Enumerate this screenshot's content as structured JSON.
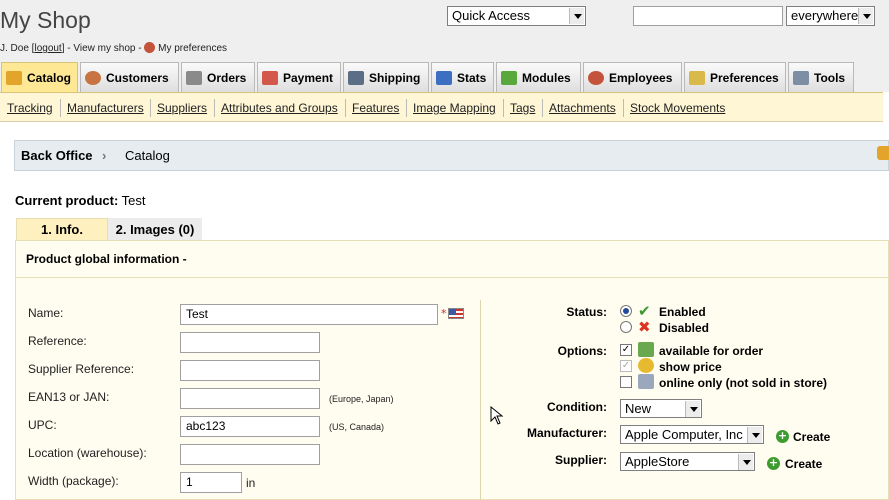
{
  "header": {
    "shop_name": "My Shop",
    "user": "J. Doe [",
    "logout": "logout",
    "user_rest": "] - View my shop -",
    "preferences": "My preferences"
  },
  "quick_access": {
    "value": "Quick Access"
  },
  "search": {
    "value": "",
    "scope": "everywhere"
  },
  "tabs": [
    {
      "label": "Catalog",
      "icon": "catalog-icon",
      "color": "#e2a42b"
    },
    {
      "label": "Customers",
      "icon": "customers-icon",
      "color": "#c87442"
    },
    {
      "label": "Orders",
      "icon": "orders-icon",
      "color": "#8a8a8a"
    },
    {
      "label": "Payment",
      "icon": "payment-icon",
      "color": "#d4584a"
    },
    {
      "label": "Shipping",
      "icon": "shipping-icon",
      "color": "#5a6f86"
    },
    {
      "label": "Stats",
      "icon": "stats-icon",
      "color": "#3c6fc2"
    },
    {
      "label": "Modules",
      "icon": "modules-icon",
      "color": "#58a83c"
    },
    {
      "label": "Employees",
      "icon": "employees-icon",
      "color": "#c4533b"
    },
    {
      "label": "Preferences",
      "icon": "preferences-icon",
      "color": "#d8b94a"
    },
    {
      "label": "Tools",
      "icon": "tools-icon",
      "color": "#7d8ea4"
    }
  ],
  "subnav": [
    "Tracking",
    "Manufacturers",
    "Suppliers",
    "Attributes and Groups",
    "Features",
    "Image Mapping",
    "Tags",
    "Attachments",
    "Stock Movements"
  ],
  "breadcrumb": {
    "root": "Back Office",
    "current": "Catalog"
  },
  "product": {
    "current_label": "Current product:",
    "current_value": "Test"
  },
  "product_tabs": [
    "1. Info.",
    "2. Images (0)"
  ],
  "section_title": "Product global information -",
  "fields": {
    "name": {
      "label": "Name:",
      "value": "Test"
    },
    "reference": {
      "label": "Reference:",
      "value": ""
    },
    "supplier_reference": {
      "label": "Supplier Reference:",
      "value": ""
    },
    "ean": {
      "label": "EAN13 or JAN:",
      "value": "",
      "hint": "(Europe, Japan)"
    },
    "upc": {
      "label": "UPC:",
      "value": "abc123",
      "hint": "(US, Canada)"
    },
    "location": {
      "label": "Location (warehouse):",
      "value": ""
    },
    "width": {
      "label": "Width (package):",
      "value": "1",
      "unit": "in"
    }
  },
  "right": {
    "status_label": "Status:",
    "enabled": "Enabled",
    "disabled": "Disabled",
    "options_label": "Options:",
    "opt1": "available for order",
    "opt2": "show price",
    "opt3": "online only (not sold in store)",
    "condition_label": "Condition:",
    "condition_value": "New",
    "manufacturer_label": "Manufacturer:",
    "manufacturer_value": "Apple Computer, Inc",
    "supplier_label": "Supplier:",
    "supplier_value": "AppleStore",
    "create": "Create"
  }
}
